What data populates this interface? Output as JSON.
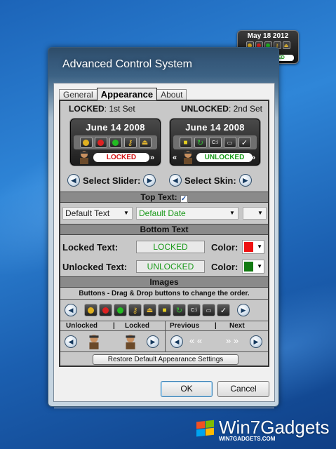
{
  "desktop": {
    "gadget": {
      "date": "May 18 2012",
      "status": "UNLOCKED"
    },
    "brand": {
      "name": "Win7Gadgets",
      "url": "WIN7GADGETS.COM"
    }
  },
  "window": {
    "title": "Advanced Control System",
    "tabs": [
      {
        "label": "General",
        "active": false
      },
      {
        "label": "Appearance",
        "active": true
      },
      {
        "label": "About",
        "active": false
      }
    ],
    "ok_label": "OK",
    "cancel_label": "Cancel"
  },
  "appearance": {
    "locked_heading": "LOCKED",
    "locked_sub": ": 1st Set",
    "unlocked_heading": "UNLOCKED",
    "unlocked_sub": ": 2nd Set",
    "preview_locked": {
      "date": "June 14 2008",
      "status": "LOCKED"
    },
    "preview_unlocked": {
      "date": "June 14 2008",
      "status": "UNLOCKED"
    },
    "select_slider_label": "Select Slider:",
    "select_skin_label": "Select Skin:",
    "top_text_label": "Top Text:",
    "top_text_checked": true,
    "top_text_format": "Default Text",
    "top_text_date": "Default Date",
    "bottom_text_label": "Bottom Text",
    "locked_text_label": "Locked Text:",
    "locked_text_value": "LOCKED",
    "unlocked_text_label": "Unlocked Text:",
    "unlocked_text_value": "UNLOCKED",
    "color_label": "Color:",
    "locked_color": "#ee1111",
    "unlocked_color": "#127a12",
    "images_label": "Images",
    "buttons_hint": "Buttons - Drag & Drop buttons to change the order.",
    "unlocked_col": "Unlocked",
    "locked_col": "Locked",
    "col_sep": "|",
    "previous_col": "Previous",
    "next_col": "Next",
    "restore_label": "Restore Default Appearance Settings"
  },
  "icons": {
    "buttons": [
      "yellow-dot-icon",
      "red-dot-icon",
      "green-dot-icon",
      "key-icon",
      "eject-icon",
      "lock-icon",
      "refresh-icon",
      "cmd-icon",
      "run-icon",
      "check-icon"
    ]
  }
}
